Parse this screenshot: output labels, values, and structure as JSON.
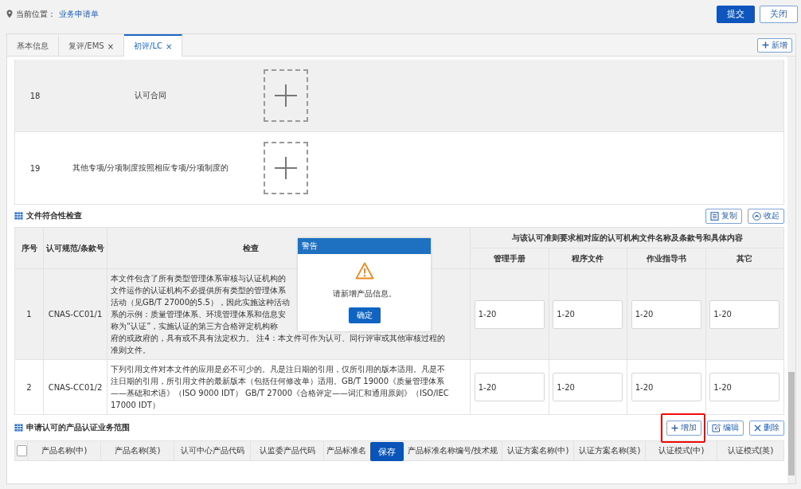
{
  "location": {
    "label": "当前位置：",
    "link": "业务申请单"
  },
  "header_buttons": [
    {
      "label": "提交",
      "kind": "primary"
    },
    {
      "label": "关闭",
      "kind": "default"
    }
  ],
  "tabs": [
    {
      "label": "基本信息",
      "selected": false
    },
    {
      "label": "复评/EMS",
      "selected": false,
      "close": "×"
    },
    {
      "label": "初评/LC",
      "selected": true,
      "close": "×"
    }
  ],
  "new_button": {
    "label": "新增"
  },
  "attachments": [
    {
      "number": "18",
      "name": "认可合同",
      "selected": true
    },
    {
      "number": "19",
      "name": "其他专项/分项制度按照相应专项/分项制度的",
      "selected": false
    }
  ],
  "compliance": {
    "title": "文件符合性检查",
    "buttons": [
      {
        "label": "复制",
        "kind": "copy"
      },
      {
        "label": "收起",
        "kind": "collapse"
      }
    ],
    "columns": {
      "number": "序号",
      "clause": "认可规范/条款号",
      "content": "检查",
      "group": "与该认可准则要求相对应的认可机构文件名称及条款号和具体内容",
      "docs": [
        "管理手册",
        "程序文件",
        "作业指导书",
        "其它"
      ]
    },
    "rows": [
      {
        "number": "1",
        "clause": "CNAS-CC01/1",
        "selected": true,
        "content_lines": [
          "本文件包含了所有类型管理体系审核与认证机构的",
          "文件运作的认证机构不必提供所有类型的管理体系",
          "活动（见GB/T 27000的5.5），因此实施这种活动",
          "系的示例：质量管理体系、环境管理体系和信息安",
          "称为“认证”，实施认证的第三方合格评定机构称",
          "府的或政府的，具有或不具有法定权力。 注4：本文件可作为认可、同行评审或其他审核过程的",
          "准则文件。"
        ],
        "values": [
          "1-20",
          "1-20",
          "1-20",
          "1-20"
        ]
      },
      {
        "number": "2",
        "clause": "CNAS-CC01/2",
        "selected": false,
        "content_lines": [
          "下列引用文件对本文件的应用是必不可少的。凡是注日期的引用，仅所引用的版本适用。凡是不",
          "注日期的引用，所引用文件的最新版本（包括任何修改单）适用。GB/T 19000《质量管理体系",
          "——基础和术语》（ISO 9000 IDT） GB/T 27000《合格评定——词汇和通用原则》（ISO/IEC",
          "17000 IDT）"
        ],
        "values": [
          "1-20",
          "1-20",
          "1-20",
          "1-20"
        ]
      }
    ]
  },
  "products": {
    "title": "申请认可的产品认证业务范围",
    "buttons": [
      {
        "label": "增加",
        "kind": "add",
        "highlighted": true
      },
      {
        "label": "编辑",
        "kind": "edit",
        "highlighted": false
      },
      {
        "label": "删除",
        "kind": "delete",
        "highlighted": false
      }
    ],
    "select_all": {
      "checked": false
    },
    "columns": [
      "产品名称(中)",
      "产品名称(英)",
      "认可中心产品代码",
      "认监委产品代码",
      "产品标准名",
      "产品标准名称编号/技术规",
      "认证方案名称(中)",
      "认证方案名称(英)",
      "认证模式(中)",
      "认证模式(英)"
    ]
  },
  "save_button": {
    "label": "保存"
  },
  "alert": {
    "title": "警告",
    "message": "请新增产品信息。",
    "button": "确定"
  }
}
